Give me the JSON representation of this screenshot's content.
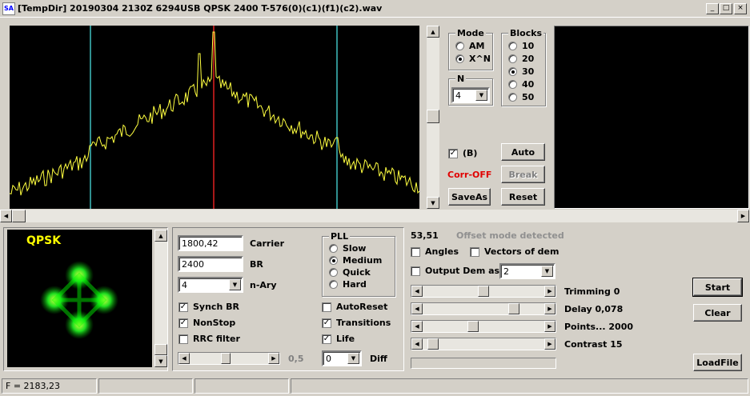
{
  "window": {
    "title": "[TempDir] 20190304 2130Z 6294USB QPSK 2400 T-576(0)(c1)(f1)(c2).wav",
    "icon_text": "SA",
    "minimize_icon": "minimize-icon",
    "maximize_icon": "maximize-icon",
    "close_icon": "close-icon"
  },
  "mode_group": {
    "title": "Mode",
    "options": [
      "AM",
      "X^N"
    ],
    "selected": "X^N"
  },
  "blocks_group": {
    "title": "Blocks",
    "options": [
      "10",
      "20",
      "30",
      "40",
      "50"
    ],
    "selected": "30"
  },
  "n_group": {
    "title": "N",
    "value": "4"
  },
  "top_controls": {
    "b_check_label": "(B)",
    "b_checked": true,
    "corr_status": "Corr-OFF",
    "corr_color": "#e00000",
    "auto_label": "Auto",
    "break_label": "Break",
    "saveas_label": "SaveAs",
    "reset_label": "Reset"
  },
  "constellation": {
    "label": "QPSK",
    "label_color": "#ffff00",
    "point_color": "#00ff00"
  },
  "modem": {
    "carrier_value": "1800,42",
    "carrier_label": "Carrier",
    "br_value": "2400",
    "br_label": "BR",
    "nary_value": "4",
    "nary_label": "n-Ary",
    "synch_br_label": "Synch BR",
    "synch_br_checked": true,
    "nonstop_label": "NonStop",
    "nonstop_checked": true,
    "rrc_label": "RRC filter",
    "rrc_checked": false,
    "rrc_value": "0,5",
    "autoreset_label": "AutoReset",
    "autoreset_checked": false,
    "transitions_label": "Transitions",
    "transitions_checked": true,
    "life_label": "Life",
    "life_checked": true,
    "diff_value": "0",
    "diff_label": "Diff"
  },
  "pll_group": {
    "title": "PLL",
    "options": [
      "Slow",
      "Medium",
      "Quick",
      "Hard"
    ],
    "selected": "Medium"
  },
  "dem": {
    "value_readout": "53,51",
    "offset_status": "Offset mode detected",
    "angles_label": "Angles",
    "angles_checked": false,
    "vectors_label": "Vectors of dem",
    "vectors_checked": false,
    "output_label": "Output Dem as",
    "output_checked": false,
    "output_value": "2",
    "trimming_label": "Trimming 0",
    "delay_label": "Delay  0,078",
    "points_label": "Points... 2000",
    "contrast_label": "Contrast 15"
  },
  "buttons": {
    "start_label": "Start",
    "clear_label": "Clear",
    "loadfile_label": "LoadFile"
  },
  "status": {
    "frequency": "F = 2183,23"
  },
  "colors": {
    "spectrum_line": "#ffff40",
    "marker_cyan": "#40c0c0",
    "marker_red": "#e02020"
  }
}
